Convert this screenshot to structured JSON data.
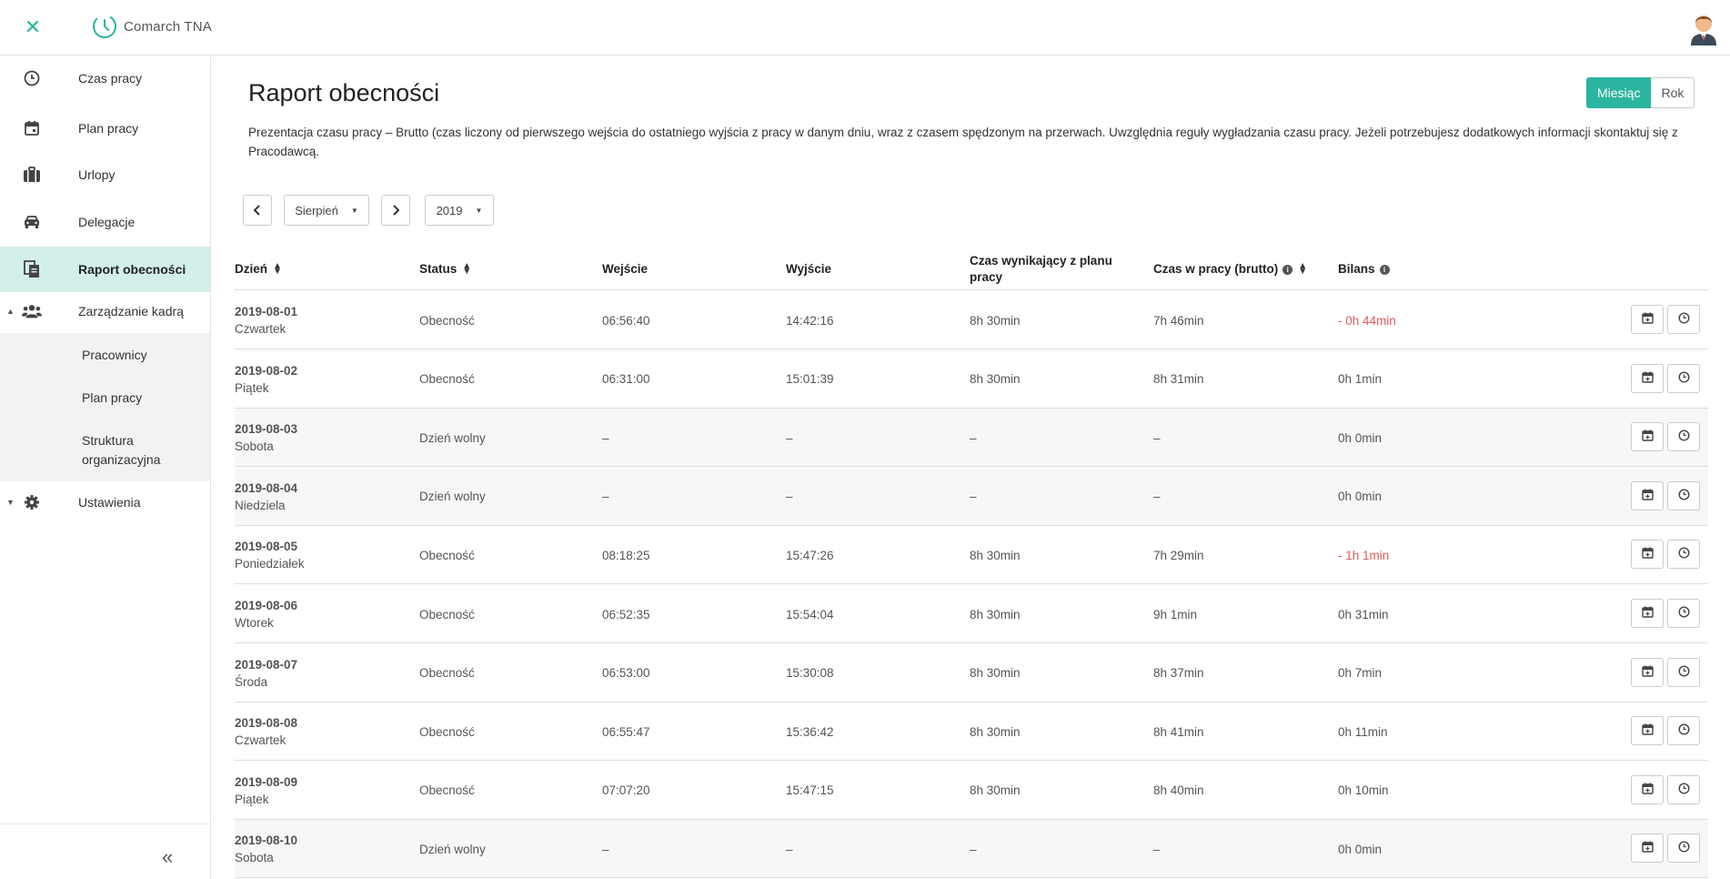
{
  "app": {
    "name": "Comarch TNA"
  },
  "sidebar": {
    "items": [
      {
        "label": "Czas pracy"
      },
      {
        "label": "Plan pracy"
      },
      {
        "label": "Urlopy"
      },
      {
        "label": "Delegacje"
      },
      {
        "label": "Raport obecności"
      },
      {
        "label": "Zarządzanie kadrą"
      },
      {
        "label": "Ustawienia"
      }
    ],
    "sub_items": [
      {
        "label": "Pracownicy"
      },
      {
        "label": "Plan pracy"
      },
      {
        "label": "Struktura organizacyjna"
      }
    ],
    "collapse_label": "«"
  },
  "page": {
    "title": "Raport obecności",
    "description": "Prezentacja czasu pracy – Brutto (czas liczony od pierwszego wejścia do ostatniego wyjścia z pracy w danym dniu, wraz z czasem spędzonym na przerwach. Uwzględnia reguły wygładzania czasu pracy. Jeżeli potrzebujesz dodatkowych informacji skontaktuj się z Pracodawcą.",
    "toggle": {
      "month": "Miesiąc",
      "year": "Rok"
    }
  },
  "filters": {
    "month": "Sierpień",
    "year": "2019"
  },
  "table": {
    "headers": {
      "day": "Dzień",
      "status": "Status",
      "entry": "Wejście",
      "exit": "Wyjście",
      "planned": "Czas wynikający z planu pracy",
      "gross": "Czas w pracy (brutto)",
      "balance": "Bilans"
    },
    "rows": [
      {
        "date": "2019-08-01",
        "weekday": "Czwartek",
        "status": "Obecność",
        "entry": "06:56:40",
        "exit": "14:42:16",
        "planned": "8h 30min",
        "gross": "7h 46min",
        "balance": "- 0h 44min",
        "negative": true
      },
      {
        "date": "2019-08-02",
        "weekday": "Piątek",
        "status": "Obecność",
        "entry": "06:31:00",
        "exit": "15:01:39",
        "planned": "8h 30min",
        "gross": "8h 31min",
        "balance": "0h 1min",
        "negative": false
      },
      {
        "date": "2019-08-03",
        "weekday": "Sobota",
        "status": "Dzień wolny",
        "entry": "–",
        "exit": "–",
        "planned": "–",
        "gross": "–",
        "balance": "0h 0min",
        "negative": false
      },
      {
        "date": "2019-08-04",
        "weekday": "Niedziela",
        "status": "Dzień wolny",
        "entry": "–",
        "exit": "–",
        "planned": "–",
        "gross": "–",
        "balance": "0h 0min",
        "negative": false
      },
      {
        "date": "2019-08-05",
        "weekday": "Poniedziałek",
        "status": "Obecność",
        "entry": "08:18:25",
        "exit": "15:47:26",
        "planned": "8h 30min",
        "gross": "7h 29min",
        "balance": "- 1h 1min",
        "negative": true
      },
      {
        "date": "2019-08-06",
        "weekday": "Wtorek",
        "status": "Obecność",
        "entry": "06:52:35",
        "exit": "15:54:04",
        "planned": "8h 30min",
        "gross": "9h 1min",
        "balance": "0h 31min",
        "negative": false
      },
      {
        "date": "2019-08-07",
        "weekday": "Środa",
        "status": "Obecność",
        "entry": "06:53:00",
        "exit": "15:30:08",
        "planned": "8h 30min",
        "gross": "8h 37min",
        "balance": "0h 7min",
        "negative": false
      },
      {
        "date": "2019-08-08",
        "weekday": "Czwartek",
        "status": "Obecność",
        "entry": "06:55:47",
        "exit": "15:36:42",
        "planned": "8h 30min",
        "gross": "8h 41min",
        "balance": "0h 11min",
        "negative": false
      },
      {
        "date": "2019-08-09",
        "weekday": "Piątek",
        "status": "Obecność",
        "entry": "07:07:20",
        "exit": "15:47:15",
        "planned": "8h 30min",
        "gross": "8h 40min",
        "balance": "0h 10min",
        "negative": false
      },
      {
        "date": "2019-08-10",
        "weekday": "Sobota",
        "status": "Dzień wolny",
        "entry": "–",
        "exit": "–",
        "planned": "–",
        "gross": "–",
        "balance": "0h 0min",
        "negative": false
      }
    ]
  },
  "colors": {
    "accent": "#2bb5a0",
    "active_bg": "#d3efea",
    "negative": "#e05a5a"
  },
  "icons": [
    "close-icon",
    "clock-icon",
    "calendar-icon",
    "briefcase-icon",
    "car-icon",
    "report-icon",
    "users-icon",
    "gear-icon",
    "chevron-left-icon",
    "chevron-right-icon",
    "calendar-plus-icon"
  ]
}
